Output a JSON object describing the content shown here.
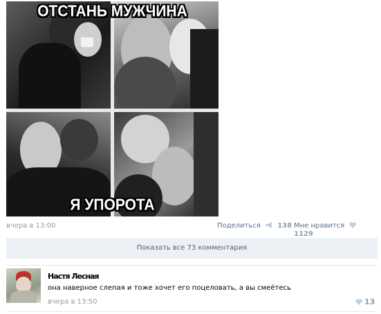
{
  "post": {
    "meme_top_text": "ОТСТАНЬ МУЖЧИНА",
    "meme_bottom_text": "Я УПОРОТА",
    "date": "вчера в 13:00",
    "share_label": "Поделиться",
    "share_count": "138",
    "like_label": "Мне нравится",
    "like_count": "1129",
    "share_icon": "megaphone-icon",
    "like_icon": "heart-icon"
  },
  "comments_bar": {
    "label": "Показать все 73 комментария"
  },
  "comment": {
    "author": "Настя Лесная",
    "text": "она наверное слепая и тоже хочет его поцеловать, а вы смеётесь",
    "date": "вчера в 13:50",
    "like_count": "13",
    "like_icon": "heart-icon"
  },
  "colors": {
    "link": "#566e8f",
    "counter": "#8aa0b8",
    "meta": "#999999",
    "bar_bg": "#edf1f5",
    "bar_text": "#4d6079"
  }
}
